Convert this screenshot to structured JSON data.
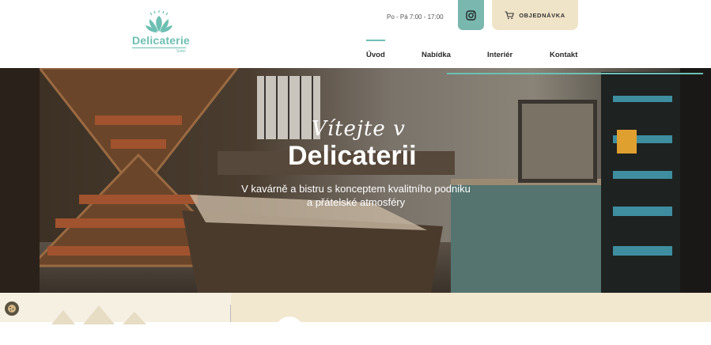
{
  "header": {
    "logo": {
      "name": "Delicaterie",
      "sub": "Soter"
    },
    "hours": "Po - Pá 7:00 - 17:00",
    "instagram_icon": "instagram-icon",
    "order_label": "OBJEDNÁVKA",
    "order_icon": "cart-icon",
    "nav": [
      {
        "label": "Úvod",
        "active": true
      },
      {
        "label": "Nabídka",
        "active": false
      },
      {
        "label": "Interiér",
        "active": false
      },
      {
        "label": "Kontakt",
        "active": false
      }
    ]
  },
  "hero": {
    "welcome": "Vítejte v",
    "title": "Delicaterii",
    "subtitle_line1": "V kavárně a bistru s konceptem kvalitního podniku",
    "subtitle_line2": "a přátelské atmosféry"
  },
  "colors": {
    "accent": "#6dbfb3",
    "cream": "#f0e4c8"
  },
  "cookie_icon": "cookie-icon"
}
